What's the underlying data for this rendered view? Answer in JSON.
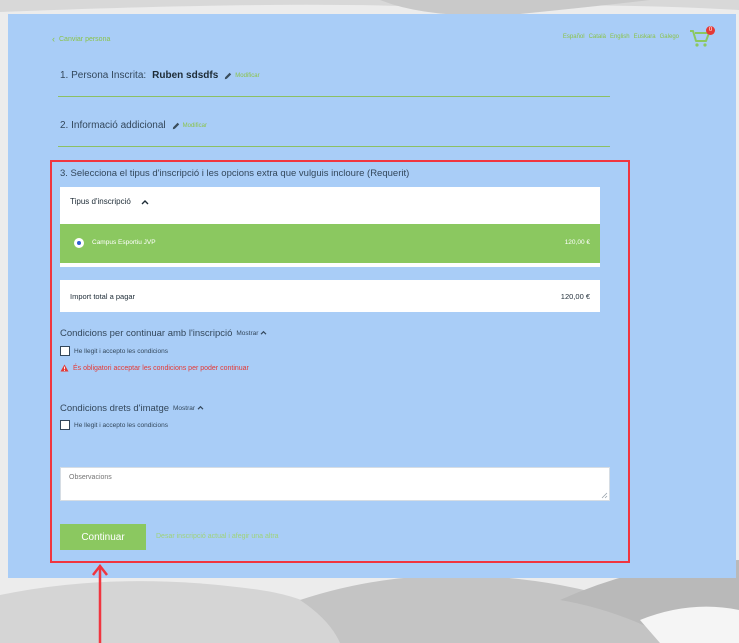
{
  "header": {
    "back_label": "Canviar persona",
    "languages": [
      "Español",
      "Català",
      "English",
      "Euskara",
      "Galego"
    ],
    "cart_count": "0"
  },
  "steps": {
    "step1_prefix": "1. Persona Inscrita:",
    "step1_name": "Ruben sdsdfs",
    "step1_edit": "Modificar",
    "step2_label": "2. Informació addicional",
    "step2_edit": "Modificar",
    "step3_label": "3. Selecciona el tipus d'inscripció i les opcions extra que vulguis incloure (Requerit)"
  },
  "registration_type": {
    "header": "Tipus d'inscripció",
    "option_label": "Campus Esportiu JVP",
    "option_price": "120,00 €"
  },
  "total": {
    "label": "Import total a pagar",
    "value": "120,00 €"
  },
  "conditions": {
    "title": "Condicions per continuar amb l'inscripció",
    "show": "Mostrar",
    "checkbox_label": "He llegit i accepto les condicions",
    "error": "És obligatori acceptar les condicions per poder continuar"
  },
  "image_rights": {
    "title": "Condicions drets d'imatge",
    "show": "Mostrar",
    "checkbox_label": "He llegit i accepto les condicions"
  },
  "observations": {
    "placeholder": "Observacions"
  },
  "actions": {
    "continue_label": "Continuar",
    "save_link": "Desar inscripció actual i afegir una altra"
  },
  "colors": {
    "panel_bg": "#a9cdf7",
    "accent_green": "#8bc860",
    "highlight_red": "#f0353f",
    "error_red": "#e53935"
  }
}
